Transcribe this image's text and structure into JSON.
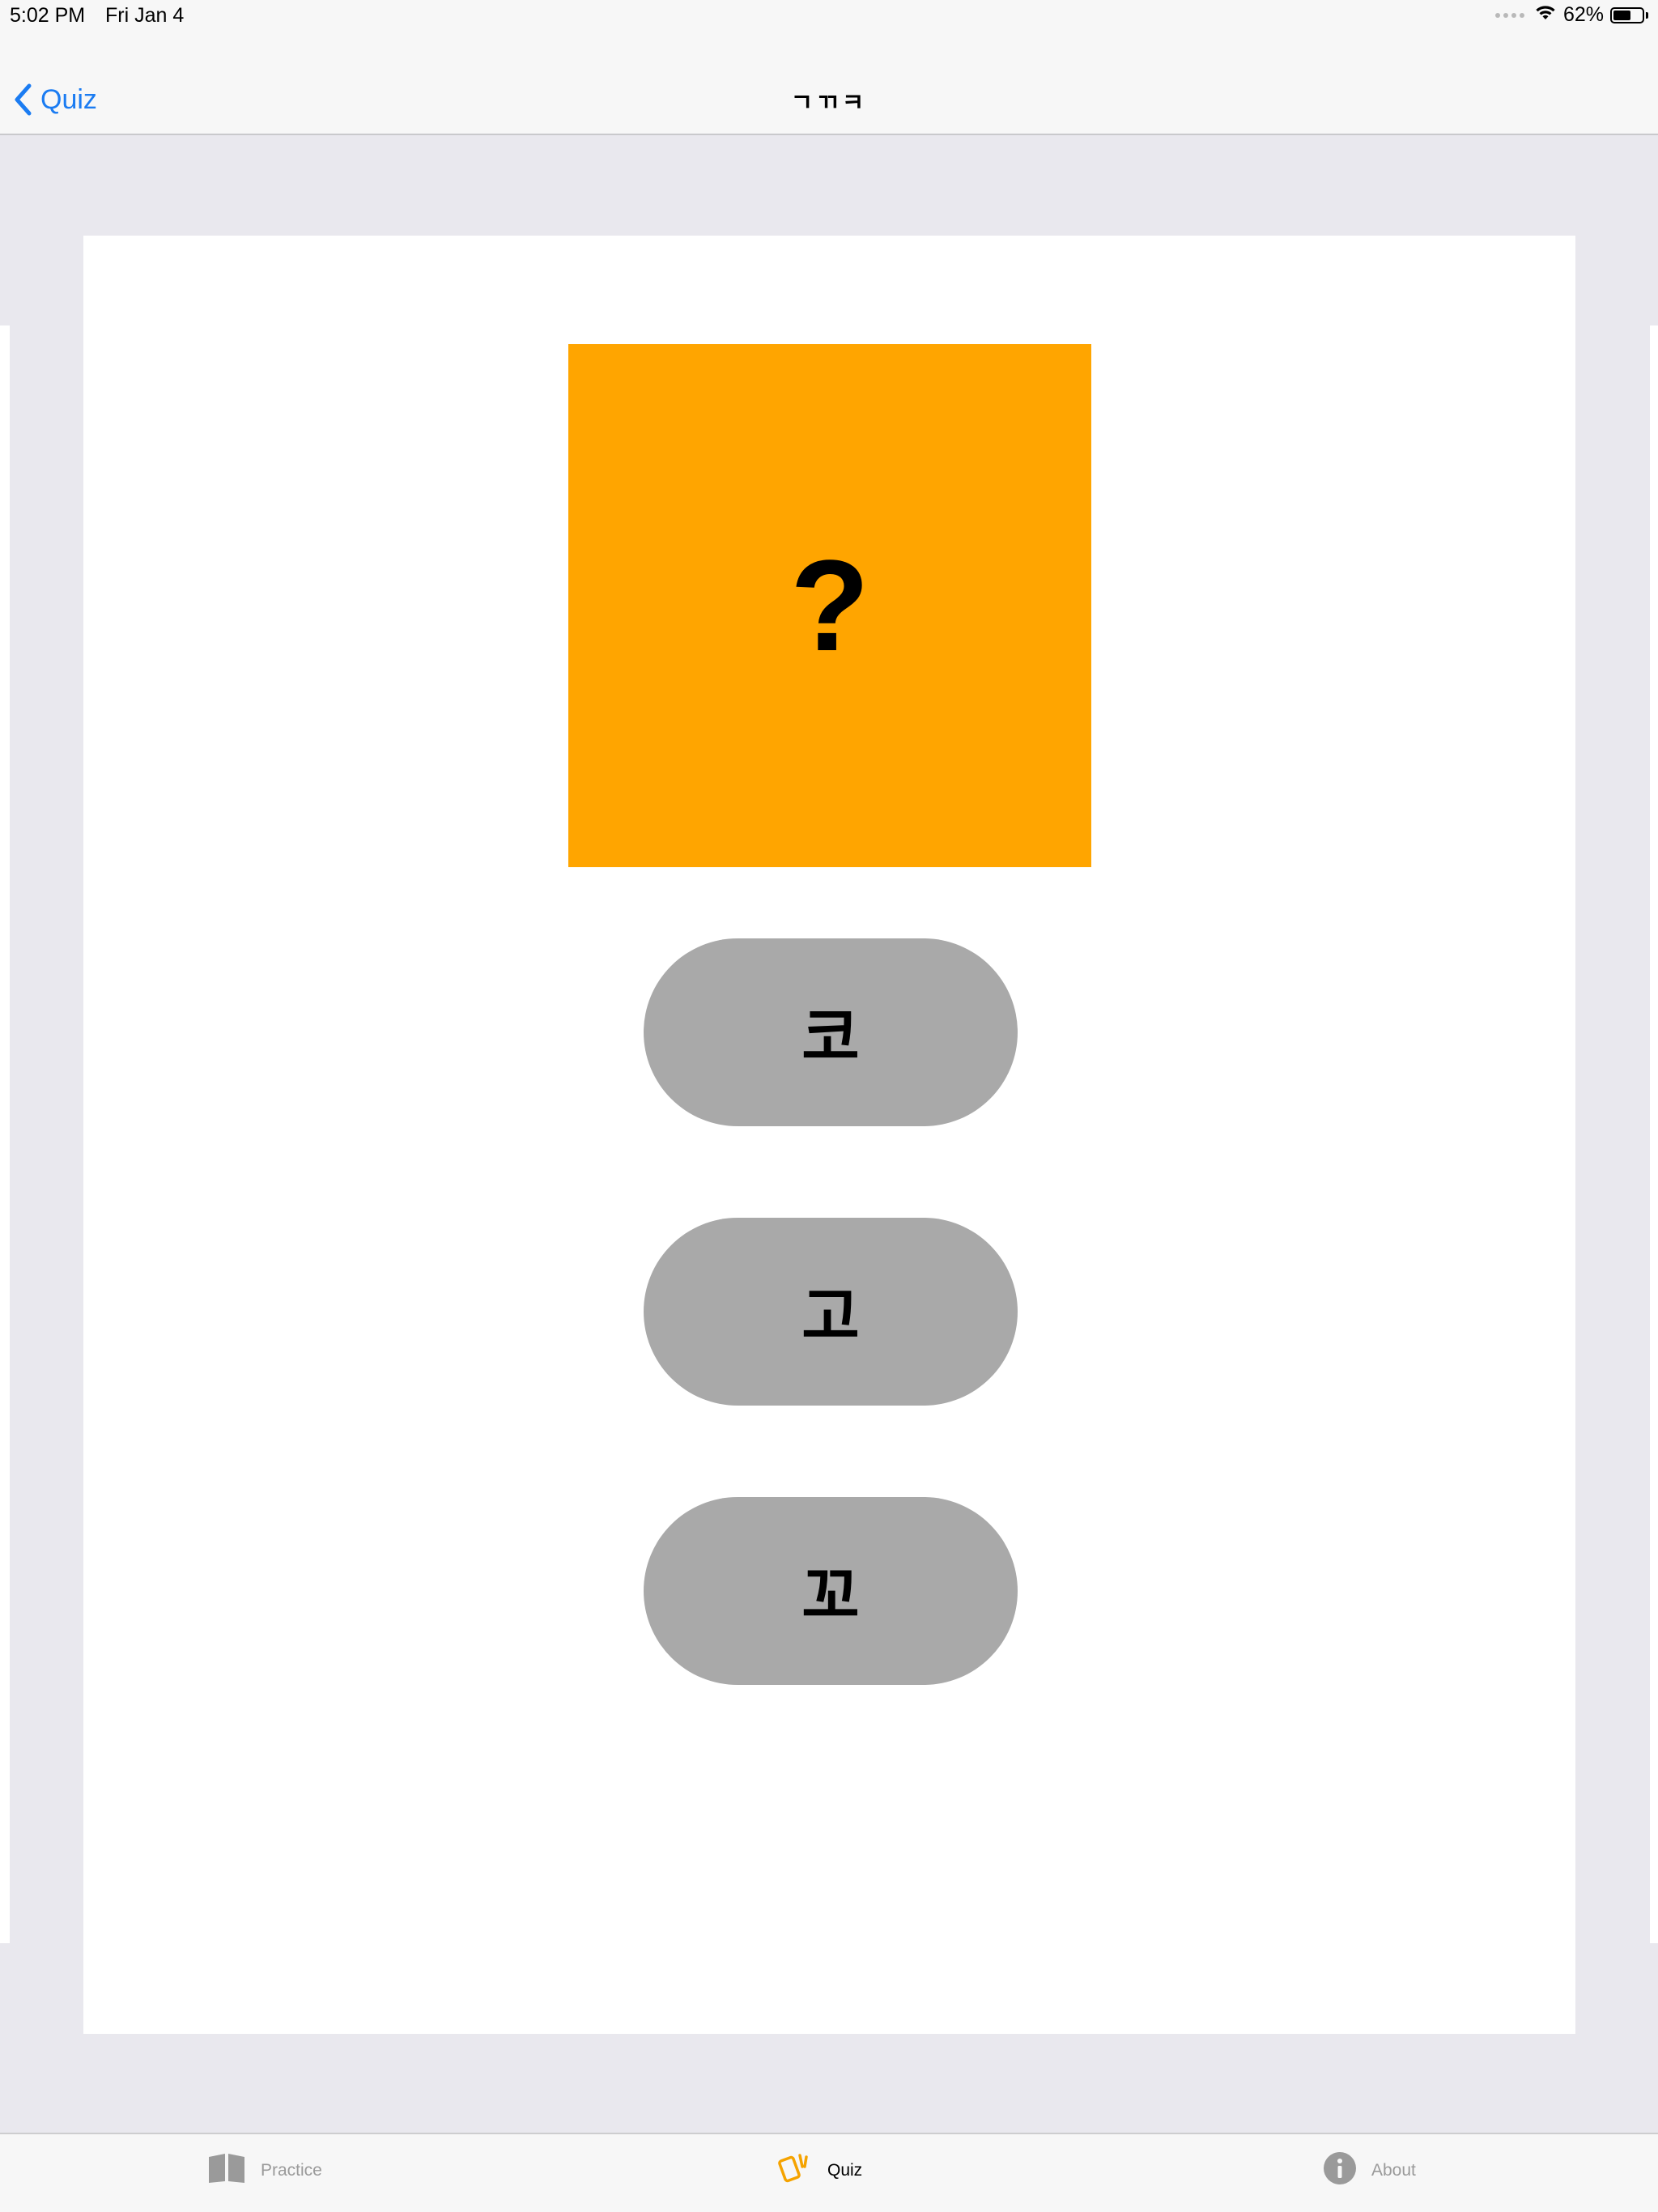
{
  "status_bar": {
    "time": "5:02 PM",
    "date": "Fri Jan 4",
    "battery_percent": "62%",
    "battery_level": 0.62
  },
  "nav": {
    "back_label": "Quiz",
    "title": "ㄱㄲㅋ"
  },
  "quiz": {
    "prompt": "?",
    "prompt_color": "#ffa500",
    "answers": [
      "코",
      "고",
      "꼬"
    ]
  },
  "tab_bar": {
    "tabs": [
      {
        "label": "Practice",
        "icon": "book-icon",
        "selected": false
      },
      {
        "label": "Quiz",
        "icon": "cards-icon",
        "selected": true
      },
      {
        "label": "About",
        "icon": "info-icon",
        "selected": false
      }
    ]
  },
  "colors": {
    "accent": "#1b7cf2",
    "quiz_tab": "#f5a300",
    "button": "#a9a9a9"
  }
}
